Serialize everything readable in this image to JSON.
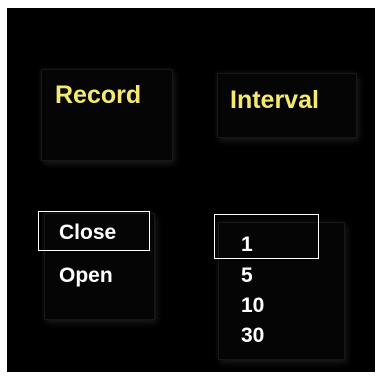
{
  "record": {
    "title": "Record",
    "options": [
      "Close",
      "Open"
    ],
    "selected": "Close"
  },
  "interval": {
    "title": "Interval",
    "options": [
      "1",
      "5",
      "10",
      "30"
    ],
    "selected": "1"
  },
  "colors": {
    "background": "#000000",
    "title_text": "#f4ea72",
    "option_text": "#ffffff",
    "selection_border": "#ffffff"
  }
}
